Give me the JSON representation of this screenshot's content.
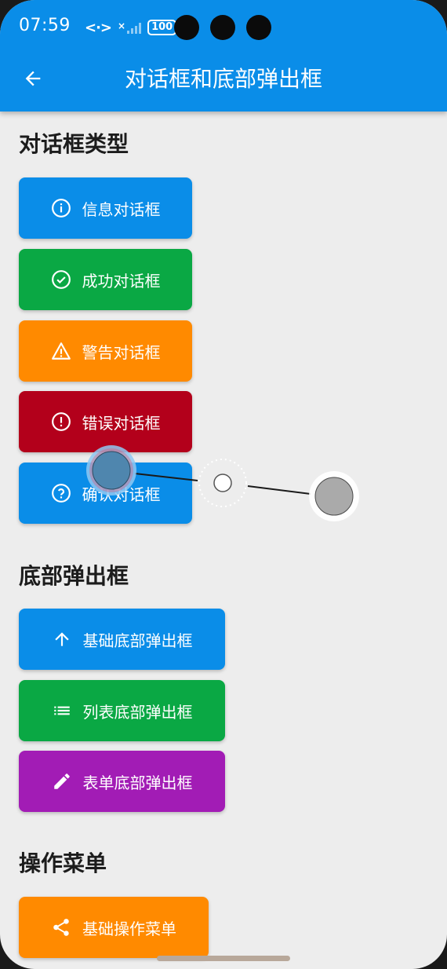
{
  "status_bar": {
    "time": "07:59",
    "network": "<·>",
    "signal_mark": "×",
    "battery": "100"
  },
  "app_bar": {
    "back_icon": "arrow-left-icon",
    "title": "对话框和底部弹出框"
  },
  "sections": {
    "dialogs": {
      "title": "对话框类型",
      "buttons": [
        {
          "label": "信息对话框",
          "icon": "info-icon",
          "color": "#0a8de8"
        },
        {
          "label": "成功对话框",
          "icon": "check-circle-icon",
          "color": "#0aa844"
        },
        {
          "label": "警告对话框",
          "icon": "warning-icon",
          "color": "#ff8a00"
        },
        {
          "label": "错误对话框",
          "icon": "error-icon",
          "color": "#b3001b"
        },
        {
          "label": "确认对话框",
          "icon": "help-icon",
          "color": "#0a8de8"
        }
      ]
    },
    "bottom_sheets": {
      "title": "底部弹出框",
      "buttons": [
        {
          "label": "基础底部弹出框",
          "icon": "arrow-up-icon",
          "color": "#0a8de8"
        },
        {
          "label": "列表底部弹出框",
          "icon": "list-icon",
          "color": "#0aa844"
        },
        {
          "label": "表单底部弹出框",
          "icon": "edit-icon",
          "color": "#a21cb5"
        }
      ]
    },
    "action_menu": {
      "title": "操作菜单",
      "buttons": [
        {
          "label": "基础操作菜单",
          "icon": "share-icon",
          "color": "#ff8a00"
        }
      ]
    }
  }
}
